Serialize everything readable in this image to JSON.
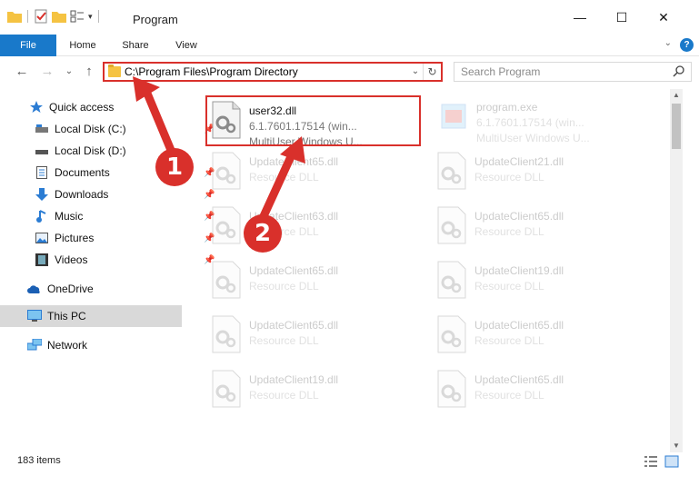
{
  "window": {
    "title": "Program",
    "minimize_glyph": "—",
    "maximize_glyph": "☐",
    "close_glyph": "✕"
  },
  "ribbon": {
    "tabs": [
      "File",
      "Home",
      "Share",
      "View"
    ],
    "help": "?",
    "chevron": "⌄"
  },
  "nav": {
    "back": "←",
    "forward": "→",
    "recent": "⌄",
    "up": "↑",
    "address": "C:\\Program Files\\Program Directory",
    "address_dropdown": "⌄",
    "refresh": "↻",
    "search_placeholder": "Search Program"
  },
  "sidebar": {
    "items": [
      {
        "label": "Quick access",
        "icon": "star-icon"
      },
      {
        "label": "Local Disk (C:)",
        "icon": "drive-icon",
        "pinned": true
      },
      {
        "label": "Local Disk (D:)",
        "icon": "drive-icon"
      },
      {
        "label": "Documents",
        "icon": "documents-icon",
        "pinned": true
      },
      {
        "label": "Downloads",
        "icon": "download-icon",
        "pinned": true
      },
      {
        "label": "Music",
        "icon": "music-icon",
        "pinned": true
      },
      {
        "label": "Pictures",
        "icon": "pictures-icon",
        "pinned": true
      },
      {
        "label": "Videos",
        "icon": "videos-icon",
        "pinned": true
      },
      {
        "label": "OneDrive",
        "icon": "cloud-icon"
      },
      {
        "label": "This PC",
        "icon": "computer-icon",
        "selected": true
      },
      {
        "label": "Network",
        "icon": "network-icon"
      }
    ]
  },
  "files": [
    {
      "name": "user32.dll",
      "line1": "6.1.7601.17514 (win...",
      "line2": "MultiUser Windows U...",
      "type": "dll"
    },
    {
      "name": "program.exe",
      "line1": "6.1.7601.17514 (win...",
      "line2": "MultiUser Windows U...",
      "type": "exe"
    },
    {
      "name": "UpdateClient65.dll",
      "line1": "Resource DLL",
      "type": "dll"
    },
    {
      "name": "UpdateClient21.dll",
      "line1": "Resource DLL",
      "type": "dll"
    },
    {
      "name": "UpdateClient63.dll",
      "line1": "Resource DLL",
      "type": "dll"
    },
    {
      "name": "UpdateClient65.dll",
      "line1": "Resource DLL",
      "type": "dll"
    },
    {
      "name": "UpdateClient65.dll",
      "line1": "Resource DLL",
      "type": "dll"
    },
    {
      "name": "UpdateClient19.dll",
      "line1": "Resource DLL",
      "type": "dll"
    },
    {
      "name": "UpdateClient65.dll",
      "line1": "Resource DLL",
      "type": "dll"
    },
    {
      "name": "UpdateClient65.dll",
      "line1": "Resource DLL",
      "type": "dll"
    },
    {
      "name": "UpdateClient19.dll",
      "line1": "Resource DLL",
      "type": "dll"
    },
    {
      "name": "UpdateClient65.dll",
      "line1": "Resource DLL",
      "type": "dll"
    }
  ],
  "status": {
    "item_count": "183 items"
  },
  "annotations": {
    "callout_1": "1",
    "callout_2": "2"
  },
  "colors": {
    "accent": "#1979ca",
    "highlight": "#d9302b",
    "selected_bg": "#d9d9d9"
  }
}
